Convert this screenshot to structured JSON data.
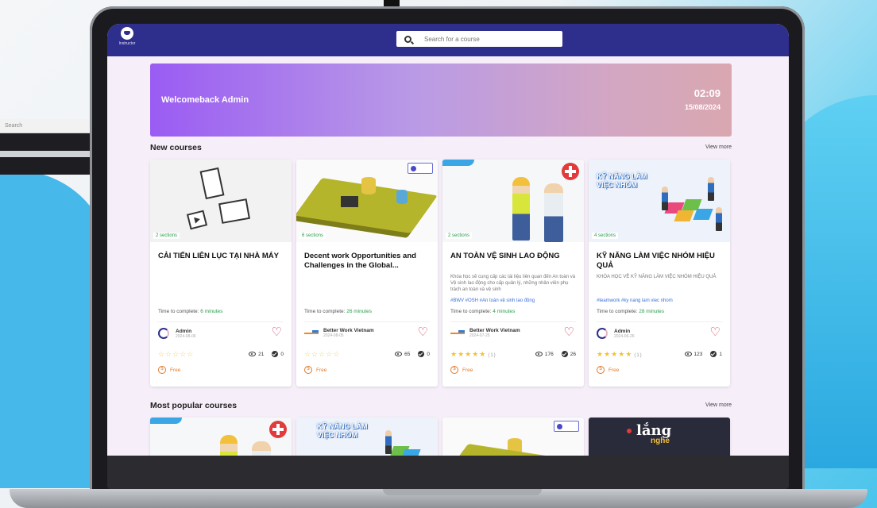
{
  "app": {
    "logo_label": "Instructor"
  },
  "search": {
    "placeholder": "Search for a course",
    "icon": "search-icon"
  },
  "welcome": {
    "title": "Welcomeback Admin",
    "time": "02:09",
    "date": "15/08/2024"
  },
  "new_courses": {
    "title": "New courses",
    "view_more": "View more",
    "cards": [
      {
        "sections": "2 sections",
        "title": "CẢI TIẾN LIÊN LỤC TẠI NHÀ MÁY",
        "description": "",
        "tags": "",
        "time_label": "Time to complete:",
        "time_value": "6 minutes",
        "author": "Admin",
        "author_date": "2024-08-06",
        "rating_count": "",
        "views": "21",
        "completions": "0",
        "price": "Free"
      },
      {
        "sections": "6 sections",
        "title": "Decent work Opportunities and Challenges in the Global...",
        "description": "",
        "tags": "",
        "time_label": "Time to complete:",
        "time_value": "26 minutes",
        "author": "Better Work Vietnam",
        "author_date": "2024-08-05",
        "rating_count": "",
        "views": "65",
        "completions": "0",
        "price": "Free"
      },
      {
        "sections": "2 sections",
        "title": "AN TOÀN VỆ SINH LAO ĐỘNG",
        "description": "Khóa học sẽ cung cấp các tài liệu liên quan đến An toàn và Vệ sinh lao động cho cấp quản lý, những nhân viên phụ trách an toàn và vệ sinh",
        "tags": "#BWV #OSH #An toàn vệ sinh lao động",
        "time_label": "Time to complete:",
        "time_value": "4 minutes",
        "author": "Better Work Vietnam",
        "author_date": "2024-07-25",
        "rating_count": "(1)",
        "views": "176",
        "completions": "26",
        "price": "Free"
      },
      {
        "sections": "4 sections",
        "title": "KỸ NĂNG LÀM VIỆC NHÓM HIỆU QUẢ",
        "description": "KHÓA HỌC VỀ KỸ NĂNG LÀM VIỆC NHÓM HIỆU QUẢ",
        "tags": "#teamwork #ky nang lam viec nhom",
        "time_label": "Time to complete:",
        "time_value": "28 minutes",
        "author": "Admin",
        "author_date": "2024-06-26",
        "rating_count": "(1)",
        "views": "123",
        "completions": "1",
        "price": "Free",
        "image_heading": "KỸ NĂNG LÀM VIỆC NHÓM"
      }
    ]
  },
  "popular_courses": {
    "title": "Most popular courses",
    "view_more": "View more",
    "thumbs": [
      {
        "name": "safety"
      },
      {
        "name": "teamwork",
        "heading": "KỸ NĂNG LÀM VIỆC NHÓM"
      },
      {
        "name": "board"
      },
      {
        "name": "lang",
        "text1": "lắng",
        "text2": "nghe"
      }
    ]
  },
  "background": {
    "left_window_text": "Search"
  },
  "colors": {
    "header": "#2e2f8c",
    "accent": "#9a5cf3",
    "heart": "#d0304a",
    "price": "#e07a2b",
    "time_value": "#2a9d4b"
  }
}
